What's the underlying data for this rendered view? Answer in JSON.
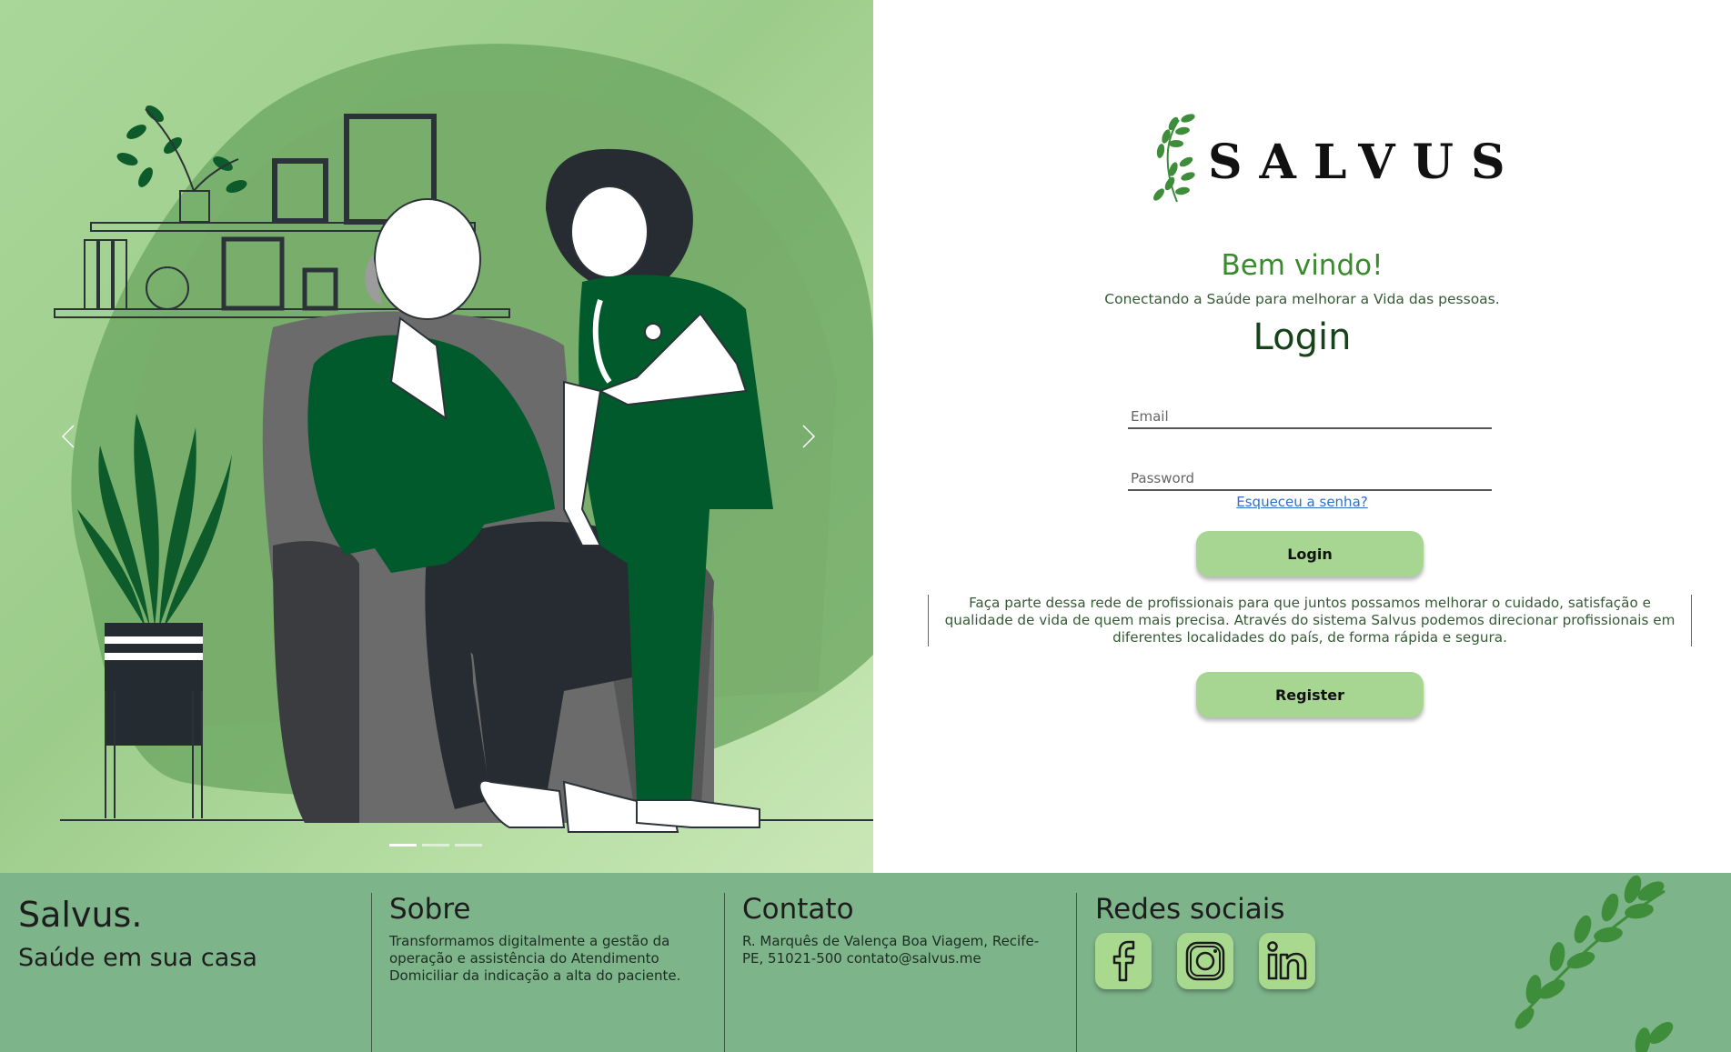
{
  "hero": {
    "slides_count": 3,
    "active_slide": 0,
    "prev_icon": "chevron-left-icon",
    "next_icon": "chevron-right-icon"
  },
  "brand": {
    "logo_text": "SALVUS",
    "logo_icon": "laurel-leaf-icon"
  },
  "auth": {
    "welcome": "Bem vindo!",
    "tagline": "Conectando a Saúde para melhorar a Vida das pessoas.",
    "title": "Login",
    "email_placeholder": "Email",
    "password_placeholder": "Password",
    "forgot_label": "Esqueceu a senha?",
    "login_label": "Login",
    "join_text": "Faça parte dessa rede de profissionais para que juntos possamos melhorar o cuidado, satisfação e qualidade de vida de quem mais precisa. Através do sistema Salvus podemos direcionar profissionais em diferentes localidades do país, de forma rápida e segura.",
    "register_label": "Register"
  },
  "footer": {
    "brand_name": "Salvus.",
    "brand_slogan": "Saúde em sua casa",
    "about_title": "Sobre",
    "about_text": "Transformamos digitalmente a gestão da operação e assistência do Atendimento Domiciliar da indicação a alta do paciente.",
    "contact_title": "Contato",
    "contact_text": "R. Marquês de Valença Boa Viagem, Recife-PE, 51021-500 contato@salvus.me",
    "social_title": "Redes sociais",
    "social_icons": [
      "facebook-icon",
      "instagram-icon",
      "linkedin-icon"
    ]
  },
  "colors": {
    "accent_green": "#3a8a2e",
    "button_green": "#a7d592",
    "footer_green": "#7db48a",
    "dark_green": "#005a2b"
  }
}
